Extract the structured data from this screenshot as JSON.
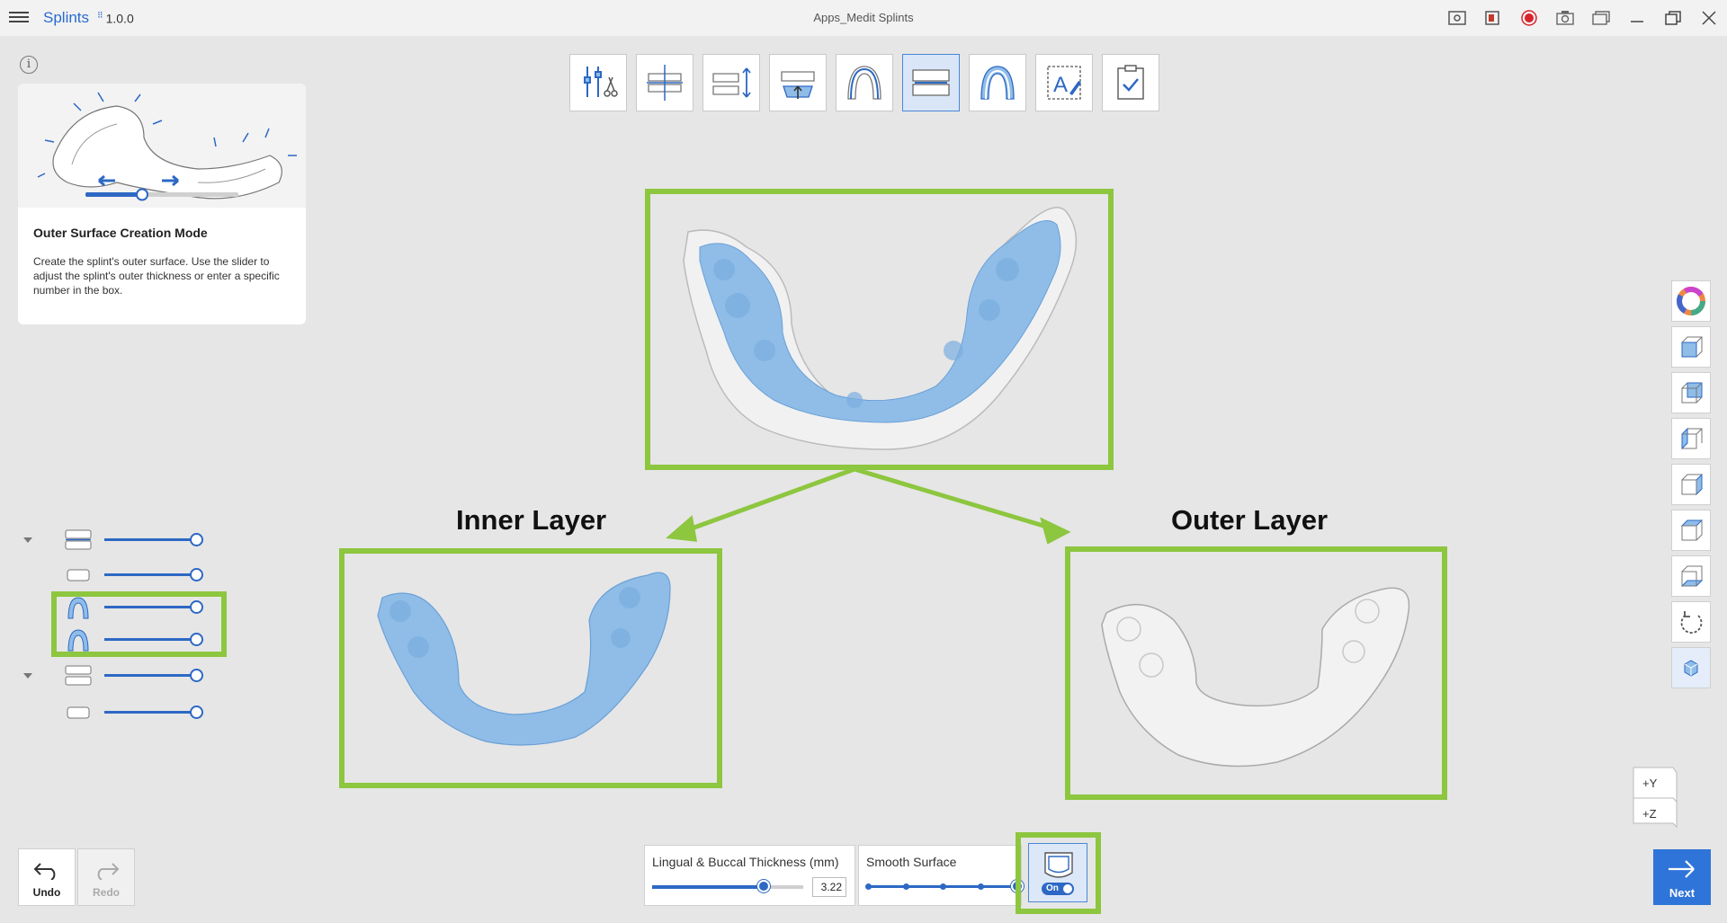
{
  "app": {
    "name": "Splints",
    "version": "1.0.0",
    "window_title": "Apps_Medit Splints"
  },
  "titlebar_icons": [
    "screenshot-icon",
    "record-area-icon",
    "record-icon",
    "camera-icon",
    "window-gallery-icon",
    "minimize-icon",
    "restore-icon",
    "close-icon"
  ],
  "help": {
    "title": "Outer Surface Creation Mode",
    "description": "Create the splint's outer surface. Use the slider to adjust the splint's outer thickness or enter a specific number in the box."
  },
  "tools": [
    {
      "name": "tool-settings",
      "icon": "tools-scissors-icon",
      "active": false
    },
    {
      "name": "tool-align-occlusion",
      "icon": "align-occlusion-icon",
      "active": false
    },
    {
      "name": "tool-insertion-direction",
      "icon": "insertion-direction-icon",
      "active": false
    },
    {
      "name": "tool-undercut",
      "icon": "undercut-icon",
      "active": false
    },
    {
      "name": "tool-margin",
      "icon": "arch-margin-icon",
      "active": false
    },
    {
      "name": "tool-outer-surface",
      "icon": "outer-surface-icon",
      "active": true
    },
    {
      "name": "tool-thickness",
      "icon": "arch-thickness-icon",
      "active": false
    },
    {
      "name": "tool-text-label",
      "icon": "text-label-icon",
      "active": false
    },
    {
      "name": "tool-finish",
      "icon": "checklist-icon",
      "active": false
    }
  ],
  "labels": {
    "inner_layer": "Inner Layer",
    "outer_layer": "Outer Layer"
  },
  "layers": [
    {
      "name": "upper-jaw-group",
      "icon": "upper-jaw-icon",
      "opacity": 1.0,
      "expandable": true
    },
    {
      "name": "upper-scan",
      "icon": "upper-scan-icon",
      "opacity": 1.0,
      "expandable": false
    },
    {
      "name": "inner-layer",
      "icon": "splint-arch-icon",
      "opacity": 1.0,
      "expandable": false
    },
    {
      "name": "outer-layer",
      "icon": "splint-arch-icon",
      "opacity": 1.0,
      "expandable": false
    },
    {
      "name": "lower-jaw-group",
      "icon": "lower-jaw-icon",
      "opacity": 1.0,
      "expandable": true
    },
    {
      "name": "lower-scan",
      "icon": "lower-scan-icon",
      "opacity": 1.0,
      "expandable": false
    }
  ],
  "view_tools": [
    "color-wheel-icon",
    "front-view-icon",
    "back-view-icon",
    "left-view-icon",
    "right-view-icon",
    "top-view-icon",
    "bottom-view-icon",
    "reset-rotation-icon",
    "solid-view-icon"
  ],
  "axis": {
    "y": "+Y",
    "z": "+Z"
  },
  "bottom": {
    "undo": "Undo",
    "redo": "Redo",
    "thickness_label": "Lingual & Buccal Thickness (mm)",
    "thickness_value": "3.22",
    "thickness_level": 0.74,
    "smooth_label": "Smooth Surface",
    "smooth_steps": 5,
    "smooth_level": 1.0,
    "toggle_label": "On",
    "next": "Next"
  },
  "colors": {
    "accent": "#2d68c4",
    "highlight": "#8dc63f",
    "splint_blue": "#8fbde8",
    "splint_white": "#f2f2f2"
  }
}
